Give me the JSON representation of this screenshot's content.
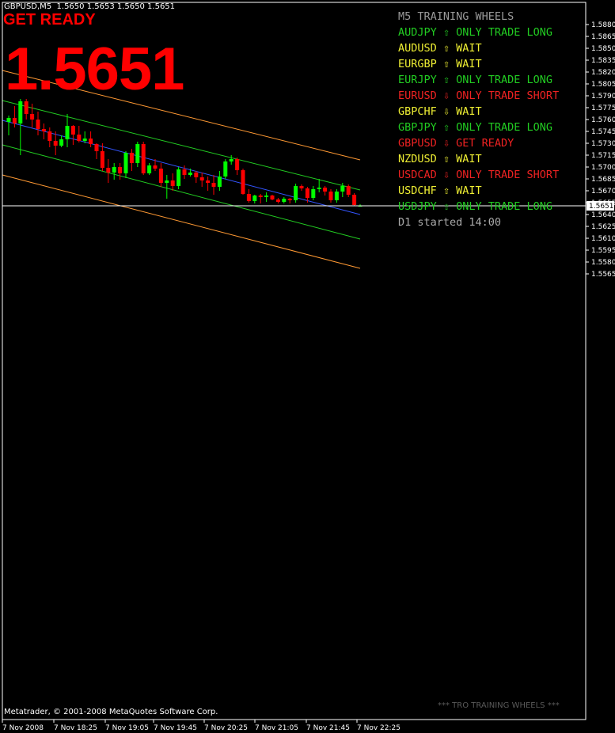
{
  "window": {
    "symbol_line": "GBPUSD,M5  1.5650 1.5653 1.5650 1.5651",
    "status_label": "GET READY",
    "status_color": "#ff0000",
    "big_price": "1.5651",
    "big_price_color": "#ff0000",
    "copyright": "Metatrader, © 2001-2008 MetaQuotes Software Corp.",
    "watermark": "*** TRO TRAINING WHEELS ***"
  },
  "panel": {
    "title": "M5 TRAINING WHEELS",
    "title_color": "#9a9a9a",
    "rows": [
      {
        "text": "AUDJPY ⇧ ONLY TRADE LONG",
        "color": "#22cc22"
      },
      {
        "text": "AUDUSD ⇧ WAIT",
        "color": "#eeee33"
      },
      {
        "text": "EURGBP ⇧ WAIT",
        "color": "#eeee33"
      },
      {
        "text": "EURJPY ⇧ ONLY TRADE LONG",
        "color": "#22cc22"
      },
      {
        "text": "EURUSD ⇩ ONLY TRADE SHORT",
        "color": "#ee2222"
      },
      {
        "text": "GBPCHF ⇩ WAIT",
        "color": "#eeee33"
      },
      {
        "text": "GBPJPY ⇧ ONLY TRADE LONG",
        "color": "#22cc22"
      },
      {
        "text": "GBPUSD ⇩ GET READY",
        "color": "#ee2222"
      },
      {
        "text": "NZDUSD ⇧ WAIT",
        "color": "#eeee33"
      },
      {
        "text": "USDCAD ⇩ ONLY TRADE SHORT",
        "color": "#ee2222"
      },
      {
        "text": "USDCHF ⇧ WAIT",
        "color": "#eeee33"
      },
      {
        "text": "USDJPY ⇧ ONLY TRADE LONG",
        "color": "#22cc22"
      }
    ],
    "footer": "D1 started 14:00",
    "footer_color": "#aaaaaa"
  },
  "chart_data": {
    "type": "candlestick",
    "ylim": [
      1.556,
      1.5895
    ],
    "y_ticks": [
      "1.5880",
      "1.5865",
      "1.5850",
      "1.5835",
      "1.5820",
      "1.5805",
      "1.5790",
      "1.5775",
      "1.5760",
      "1.5745",
      "1.5730",
      "1.5715",
      "1.5700",
      "1.5685",
      "1.5670",
      "1.5655",
      "1.5640",
      "1.5625",
      "1.5610",
      "1.5595",
      "1.5580",
      "1.5565"
    ],
    "current_price_label": "1.5651",
    "current_price": 1.5651,
    "x_ticks": [
      "7 Nov 2008",
      "7 Nov 18:25",
      "7 Nov 19:05",
      "7 Nov 19:45",
      "7 Nov 20:25",
      "7 Nov 21:05",
      "7 Nov 21:45",
      "7 Nov 22:25"
    ],
    "colors": {
      "up": "#00ff00",
      "down": "#ff0000",
      "mid": "#3355ff",
      "inner": "#22cc22",
      "outer": "#ff9933",
      "axis": "#ffffff"
    },
    "candles": [
      {
        "o": 1.5757,
        "h": 1.5765,
        "l": 1.574,
        "c": 1.5762
      },
      {
        "o": 1.5762,
        "h": 1.5777,
        "l": 1.575,
        "c": 1.5755
      },
      {
        "o": 1.5755,
        "h": 1.5786,
        "l": 1.5715,
        "c": 1.5783
      },
      {
        "o": 1.5783,
        "h": 1.5786,
        "l": 1.576,
        "c": 1.5767
      },
      {
        "o": 1.5767,
        "h": 1.578,
        "l": 1.575,
        "c": 1.576
      },
      {
        "o": 1.576,
        "h": 1.577,
        "l": 1.574,
        "c": 1.5748
      },
      {
        "o": 1.5748,
        "h": 1.5755,
        "l": 1.5735,
        "c": 1.5745
      },
      {
        "o": 1.5745,
        "h": 1.575,
        "l": 1.5725,
        "c": 1.5733
      },
      {
        "o": 1.5733,
        "h": 1.5745,
        "l": 1.5715,
        "c": 1.5727
      },
      {
        "o": 1.5727,
        "h": 1.574,
        "l": 1.5725,
        "c": 1.5735
      },
      {
        "o": 1.5735,
        "h": 1.5767,
        "l": 1.5725,
        "c": 1.5752
      },
      {
        "o": 1.5752,
        "h": 1.5753,
        "l": 1.5728,
        "c": 1.5741
      },
      {
        "o": 1.5741,
        "h": 1.5752,
        "l": 1.5731,
        "c": 1.5733
      },
      {
        "o": 1.5733,
        "h": 1.5745,
        "l": 1.573,
        "c": 1.5736
      },
      {
        "o": 1.5736,
        "h": 1.5745,
        "l": 1.5725,
        "c": 1.5729
      },
      {
        "o": 1.5729,
        "h": 1.573,
        "l": 1.571,
        "c": 1.572
      },
      {
        "o": 1.572,
        "h": 1.573,
        "l": 1.5695,
        "c": 1.5699
      },
      {
        "o": 1.5699,
        "h": 1.571,
        "l": 1.568,
        "c": 1.5693
      },
      {
        "o": 1.5693,
        "h": 1.5705,
        "l": 1.5684,
        "c": 1.57
      },
      {
        "o": 1.57,
        "h": 1.5705,
        "l": 1.5684,
        "c": 1.5692
      },
      {
        "o": 1.5692,
        "h": 1.572,
        "l": 1.5686,
        "c": 1.5718
      },
      {
        "o": 1.5718,
        "h": 1.5723,
        "l": 1.5695,
        "c": 1.5705
      },
      {
        "o": 1.5705,
        "h": 1.5732,
        "l": 1.57,
        "c": 1.5729
      },
      {
        "o": 1.5729,
        "h": 1.5732,
        "l": 1.569,
        "c": 1.5692
      },
      {
        "o": 1.5692,
        "h": 1.5705,
        "l": 1.569,
        "c": 1.5702
      },
      {
        "o": 1.5702,
        "h": 1.571,
        "l": 1.5695,
        "c": 1.5698
      },
      {
        "o": 1.5698,
        "h": 1.5705,
        "l": 1.5675,
        "c": 1.568
      },
      {
        "o": 1.568,
        "h": 1.569,
        "l": 1.566,
        "c": 1.5683
      },
      {
        "o": 1.5683,
        "h": 1.5692,
        "l": 1.567,
        "c": 1.5676
      },
      {
        "o": 1.5676,
        "h": 1.57,
        "l": 1.5672,
        "c": 1.5697
      },
      {
        "o": 1.5697,
        "h": 1.5702,
        "l": 1.5685,
        "c": 1.569
      },
      {
        "o": 1.569,
        "h": 1.5698,
        "l": 1.5688,
        "c": 1.5693
      },
      {
        "o": 1.5693,
        "h": 1.5695,
        "l": 1.568,
        "c": 1.5687
      },
      {
        "o": 1.5687,
        "h": 1.5693,
        "l": 1.5675,
        "c": 1.5683
      },
      {
        "o": 1.5683,
        "h": 1.5688,
        "l": 1.567,
        "c": 1.568
      },
      {
        "o": 1.568,
        "h": 1.569,
        "l": 1.5665,
        "c": 1.5675
      },
      {
        "o": 1.5675,
        "h": 1.5695,
        "l": 1.567,
        "c": 1.5688
      },
      {
        "o": 1.5688,
        "h": 1.571,
        "l": 1.5685,
        "c": 1.5707
      },
      {
        "o": 1.5707,
        "h": 1.5715,
        "l": 1.5703,
        "c": 1.571
      },
      {
        "o": 1.571,
        "h": 1.5712,
        "l": 1.569,
        "c": 1.5696
      },
      {
        "o": 1.5696,
        "h": 1.5698,
        "l": 1.5665,
        "c": 1.5666
      },
      {
        "o": 1.5666,
        "h": 1.5672,
        "l": 1.5655,
        "c": 1.5657
      },
      {
        "o": 1.5657,
        "h": 1.5665,
        "l": 1.5654,
        "c": 1.5664
      },
      {
        "o": 1.5664,
        "h": 1.5666,
        "l": 1.5654,
        "c": 1.5662
      },
      {
        "o": 1.5662,
        "h": 1.5668,
        "l": 1.5656,
        "c": 1.5664
      },
      {
        "o": 1.5664,
        "h": 1.5665,
        "l": 1.5658,
        "c": 1.5659
      },
      {
        "o": 1.5659,
        "h": 1.5661,
        "l": 1.5654,
        "c": 1.5656
      },
      {
        "o": 1.5656,
        "h": 1.5662,
        "l": 1.5654,
        "c": 1.566
      },
      {
        "o": 1.566,
        "h": 1.5661,
        "l": 1.5654,
        "c": 1.5658
      },
      {
        "o": 1.5658,
        "h": 1.5679,
        "l": 1.5655,
        "c": 1.5676
      },
      {
        "o": 1.5676,
        "h": 1.5678,
        "l": 1.567,
        "c": 1.5673
      },
      {
        "o": 1.5673,
        "h": 1.5675,
        "l": 1.5655,
        "c": 1.5661
      },
      {
        "o": 1.5661,
        "h": 1.5676,
        "l": 1.5658,
        "c": 1.5672
      },
      {
        "o": 1.5672,
        "h": 1.5685,
        "l": 1.5668,
        "c": 1.5674
      },
      {
        "o": 1.5674,
        "h": 1.5676,
        "l": 1.5664,
        "c": 1.5669
      },
      {
        "o": 1.5669,
        "h": 1.5672,
        "l": 1.5655,
        "c": 1.5658
      },
      {
        "o": 1.5658,
        "h": 1.5672,
        "l": 1.5655,
        "c": 1.5669
      },
      {
        "o": 1.5669,
        "h": 1.568,
        "l": 1.5662,
        "c": 1.5676
      },
      {
        "o": 1.5676,
        "h": 1.5678,
        "l": 1.5662,
        "c": 1.5665
      },
      {
        "o": 1.5665,
        "h": 1.5667,
        "l": 1.5651,
        "c": 1.5652
      },
      {
        "o": 1.565,
        "h": 1.5653,
        "l": 1.565,
        "c": 1.5651
      }
    ],
    "channels": [
      {
        "name": "outer-upper",
        "color": "#ff9933",
        "start": 1.5822,
        "end": 1.5709
      },
      {
        "name": "inner-upper",
        "color": "#22cc22",
        "start": 1.5784,
        "end": 1.5671
      },
      {
        "name": "mid",
        "color": "#3355ff",
        "start": 1.5759,
        "end": 1.564
      },
      {
        "name": "inner-lower",
        "color": "#22cc22",
        "start": 1.5728,
        "end": 1.5609
      },
      {
        "name": "outer-lower",
        "color": "#ff9933",
        "start": 1.569,
        "end": 1.5572
      }
    ]
  }
}
